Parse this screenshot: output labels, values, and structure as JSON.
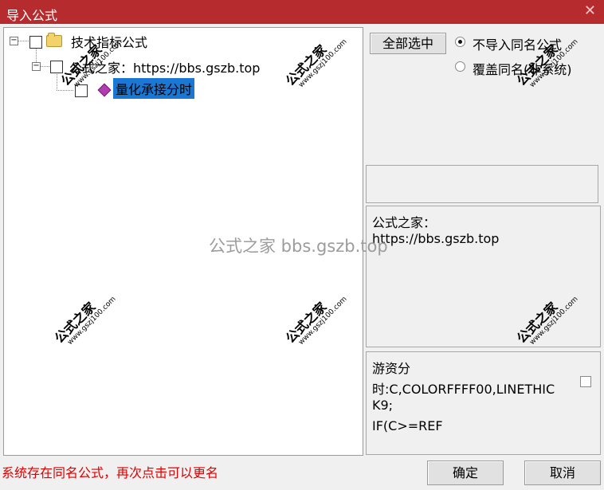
{
  "window": {
    "title": "导入公式",
    "close_glyph": "✕"
  },
  "tree": {
    "root_label": "技术指标公式",
    "source_label": "公式之家：https://bbs.gszb.top",
    "formula_label": "量化承接分时"
  },
  "buttons": {
    "select_all": "全部选中",
    "ok": "确定",
    "cancel": "取消"
  },
  "options": {
    "skip_same_name": "不导入同名公式",
    "overwrite_same_name": "覆盖同名(非系统)",
    "selected": "skip_same_name"
  },
  "info": {
    "line1": "公式之家：",
    "line2": "https://bbs.gszb.top"
  },
  "source_preview": {
    "line1": "游资分",
    "line2": "时:C,COLORFFFF00,LINETHIC",
    "line3": "K9;",
    "line4": "IF(C>=REF"
  },
  "status": "系统存在同名公式，再次点击可以更名",
  "watermarks": {
    "text": "公式之家",
    "url": "www.gszj100.com",
    "center": "公式之家 bbs.gszb.top"
  },
  "colors": {
    "title_bar": "#b52b2e",
    "selection": "#1a78d4",
    "status_text": "#e00000"
  }
}
